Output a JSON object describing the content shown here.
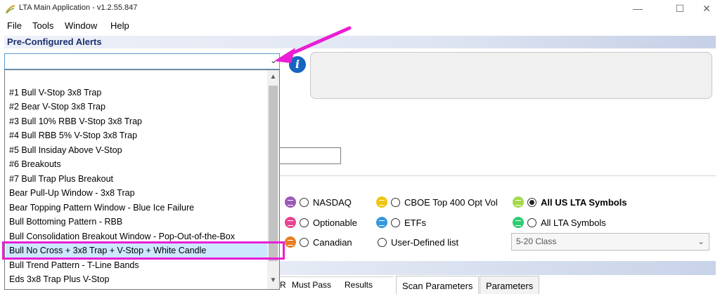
{
  "window": {
    "title": "LTA Main Application  -  v1.2.55.847",
    "minimize": "—",
    "maximize": "☐",
    "close": "✕"
  },
  "menu": [
    "File",
    "Tools",
    "Window",
    "Help"
  ],
  "section": {
    "title": "Pre-Configured Alerts"
  },
  "combo": {
    "value": "",
    "arrow": "⌄"
  },
  "info_icon": "i",
  "dropdown": {
    "items": [
      "#1 Bull V-Stop 3x8 Trap",
      "#2 Bear V-Stop 3x8 Trap",
      "#3 Bull 10% RBB V-Stop 3x8 Trap",
      "#4 Bull RBB 5% V-Stop 3x8 Trap",
      "#5 Bull Insiday Above V-Stop",
      "#6 Breakouts",
      "#7 Bull Trap Plus Breakout",
      "Bear Pull-Up Window - 3x8 Trap",
      "Bear Topping Pattern Window - Blue Ice Failure",
      "Bull Bottoming Pattern - RBB",
      "Bull Consolidation Breakout Window - Pop-Out-of-the-Box",
      "Bull No Cross + 3x8 Trap + V-Stop + White Candle",
      "Bull Trend Pattern - T-Line Bands",
      "Eds 3x8 Trap Plus V-Stop"
    ],
    "selected_index": 11,
    "scroll_up": "▲",
    "scroll_down": "▼"
  },
  "symbol_lists": {
    "options": [
      {
        "label": "NASDAQ",
        "dot_color": "#9b59b6",
        "checked": false
      },
      {
        "label": "Optionable",
        "dot_color": "#e84393",
        "checked": false
      },
      {
        "label": "Canadian",
        "dot_color": "#e67e22",
        "checked": false
      },
      {
        "label": "CBOE Top 400 Opt Vol",
        "dot_color": "#f1c40f",
        "checked": false
      },
      {
        "label": "ETFs",
        "dot_color": "#3498db",
        "checked": false
      },
      {
        "label": "User-Defined list",
        "dot_color": null,
        "checked": false
      },
      {
        "label": "All US LTA Symbols",
        "dot_color": "#a3d94a",
        "checked": true
      },
      {
        "label": "All LTA Symbols",
        "dot_color": "#2ecc71",
        "checked": false
      }
    ],
    "class_select": {
      "value": "5-20 Class",
      "arrow": "⌄"
    }
  },
  "table_headers": [
    "R",
    "Must Pass",
    "Results"
  ],
  "tabs": [
    {
      "label": "Scan Parameters",
      "active": true
    },
    {
      "label": "Parameters",
      "active": false
    }
  ],
  "colors": {
    "highlight": "#cce8ff",
    "annotation": "#e91ed5",
    "section_text": "#1a2f6e"
  }
}
